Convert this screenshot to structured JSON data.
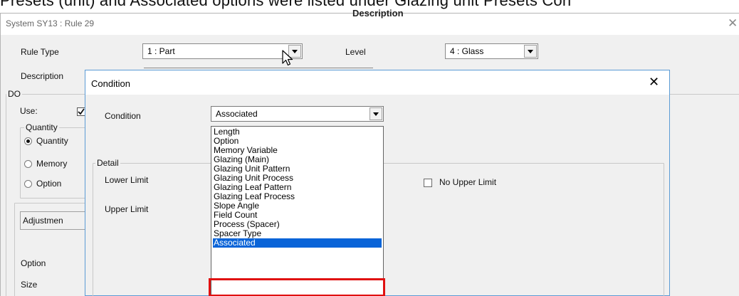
{
  "document": {
    "caption": "Presets (unit) and Associated options were listed under Glazing unit Presets Con",
    "heading": "Description"
  },
  "window": {
    "title": "System SY13 : Rule 29",
    "close_glyph": "✕"
  },
  "form": {
    "rule_type_label": "Rule Type",
    "rule_type_value": "1 : Part",
    "level_label": "Level",
    "level_value": "4 : Glass",
    "description_label": "Description",
    "do_group": "DO",
    "use_label": "Use:",
    "quantity_group": "Quantity",
    "quantity_option": "Quantity",
    "memory_option": "Memory",
    "option_option": "Option",
    "adjustment_tab": "Adjustmen",
    "option_label": "Option",
    "size_label": "Size"
  },
  "dialog": {
    "title": "Condition",
    "close_glyph": "✕",
    "condition_label": "Condition",
    "condition_value": "Associated",
    "detail_group": "Detail",
    "lower_limit_label": "Lower Limit",
    "upper_limit_label": "Upper Limit",
    "no_upper_limit_label": "No Upper Limit",
    "options": [
      "Length",
      "Option",
      "Memory Variable",
      "Glazing (Main)",
      "Glazing Unit Pattern",
      "Glazing Unit Process",
      "Glazing Leaf Pattern",
      "Glazing Leaf Process",
      "Slope Angle",
      "Field Count",
      "Process (Spacer)",
      "Spacer Type",
      "Associated"
    ],
    "selected_index": 12,
    "highlight_color": "#e01010",
    "selection_color": "#0a64d8"
  }
}
